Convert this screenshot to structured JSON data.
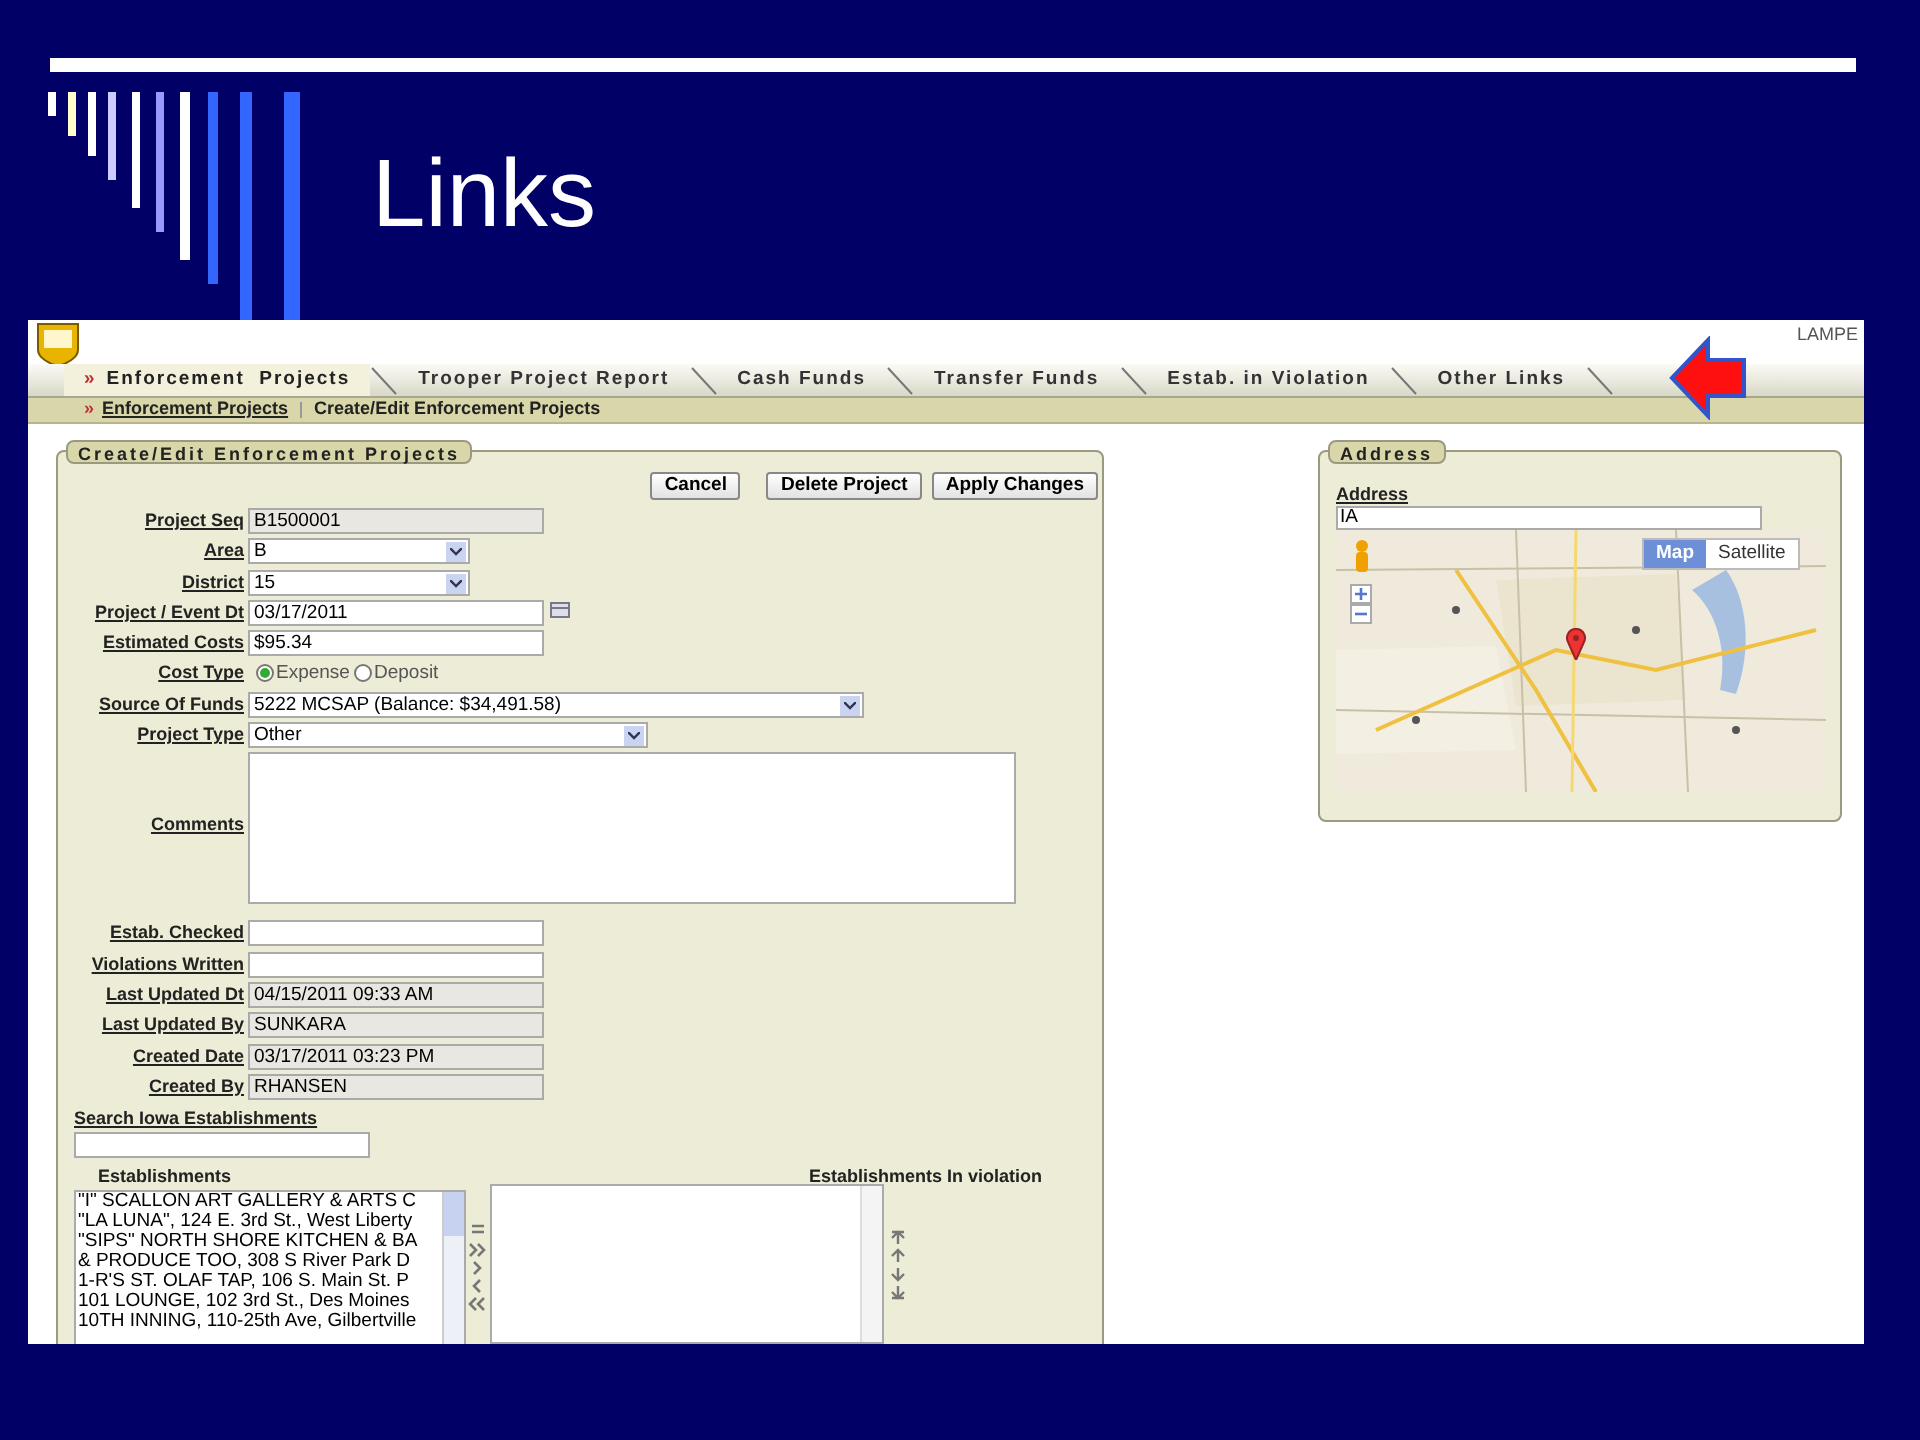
{
  "slide": {
    "title": "Links"
  },
  "app": {
    "user": "LAMPE",
    "tab_marker": "»",
    "tabs": [
      {
        "label": "Enforcement  Projects",
        "selected": true
      },
      {
        "label": "Trooper Project Report",
        "selected": false
      },
      {
        "label": "Cash Funds",
        "selected": false
      },
      {
        "label": "Transfer Funds",
        "selected": false
      },
      {
        "label": "Estab. in Violation",
        "selected": false
      },
      {
        "label": "Other Links",
        "selected": false
      }
    ],
    "breadcrumb": [
      {
        "kind": "link",
        "marker": "»",
        "label": "Enforcement Projects"
      },
      {
        "kind": "current",
        "label": "Create/Edit Enforcement Projects"
      }
    ],
    "form": {
      "title": "Create/Edit Enforcement Projects",
      "buttons": [
        "Cancel",
        "Delete Project",
        "Apply Changes"
      ],
      "fields": [
        {
          "kind": "readonly",
          "label": "Project Seq",
          "value": "B1500001"
        },
        {
          "kind": "select",
          "label": "Area",
          "value": "B"
        },
        {
          "kind": "select",
          "label": "District",
          "value": "15"
        },
        {
          "kind": "date",
          "label": "Project / Event Dt",
          "value": "03/17/2011"
        },
        {
          "kind": "text",
          "label": "Estimated Costs",
          "value": "$95.34"
        },
        {
          "kind": "radio",
          "label": "Cost Type",
          "options": [
            {
              "label": "Expense",
              "selected": true
            },
            {
              "label": "Deposit",
              "selected": false
            }
          ]
        },
        {
          "kind": "select",
          "label": "Source Of Funds",
          "value": "5222 MCSAP (Balance: $34,491.58)"
        },
        {
          "kind": "select",
          "label": "Project Type",
          "value": "Other"
        },
        {
          "kind": "textarea",
          "label": "Comments"
        },
        {
          "kind": "text",
          "label": "Estab. Checked"
        },
        {
          "kind": "text",
          "label": "Violations Written"
        },
        {
          "kind": "readonly",
          "label": "Last Updated Dt",
          "value": "04/15/2011 09:33 AM"
        },
        {
          "kind": "readonly",
          "label": "Last Updated By",
          "value": "SUNKARA"
        },
        {
          "kind": "readonly",
          "label": "Created Date",
          "value": "03/17/2011 03:23 PM"
        },
        {
          "kind": "readonly",
          "label": "Created By",
          "value": "RHANSEN"
        }
      ],
      "search": {
        "label": "Search Iowa Establishments"
      },
      "establishments": {
        "label": "Establishments",
        "items": [
          "\"I\" SCALLON ART GALLERY & ARTS C",
          "\"LA LUNA\", 124 E. 3rd St., West Liberty",
          "\"SIPS\" NORTH SHORE KITCHEN & BA",
          "& PRODUCE TOO, 308 S River Park D",
          "1-R'S ST. OLAF TAP, 106 S. Main St. P",
          "101 LOUNGE, 102 3rd St., Des Moines",
          "10TH INNING, 110-25th Ave, Gilbertville"
        ]
      },
      "violations": {
        "label": "Establishments In violation"
      }
    },
    "address": {
      "title": "Address",
      "label": "Address",
      "value": "IA",
      "map_types": [
        {
          "label": "Map",
          "selected": true
        },
        {
          "label": "Satellite",
          "selected": false
        }
      ]
    }
  }
}
